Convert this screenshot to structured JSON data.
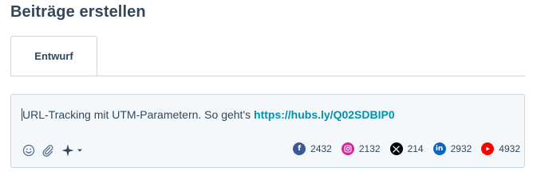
{
  "page": {
    "title": "Beiträge erstellen"
  },
  "tabs": [
    {
      "label": "Entwurf",
      "active": true
    }
  ],
  "composer": {
    "text": "URL-Tracking mit UTM-Parametern. So geht's ",
    "link": "https://hubs.ly/Q02SDBIP0",
    "link_color": "#0091ae"
  },
  "toolbar": {
    "icons": [
      "emoji-icon",
      "attachment-icon",
      "ai-sparkle-icon",
      "chevron-down-icon"
    ]
  },
  "network_counts": [
    {
      "network": "facebook",
      "icon": "facebook-icon",
      "color": "#3b5998",
      "count": "2432"
    },
    {
      "network": "instagram",
      "icon": "instagram-icon",
      "color": "#d6249f",
      "count": "2132"
    },
    {
      "network": "x",
      "icon": "x-icon",
      "color": "#000000",
      "count": "214"
    },
    {
      "network": "linkedin",
      "icon": "linkedin-icon",
      "color": "#0a66c2",
      "count": "2932"
    },
    {
      "network": "youtube",
      "icon": "youtube-icon",
      "color": "#ff0000",
      "count": "4932"
    }
  ]
}
